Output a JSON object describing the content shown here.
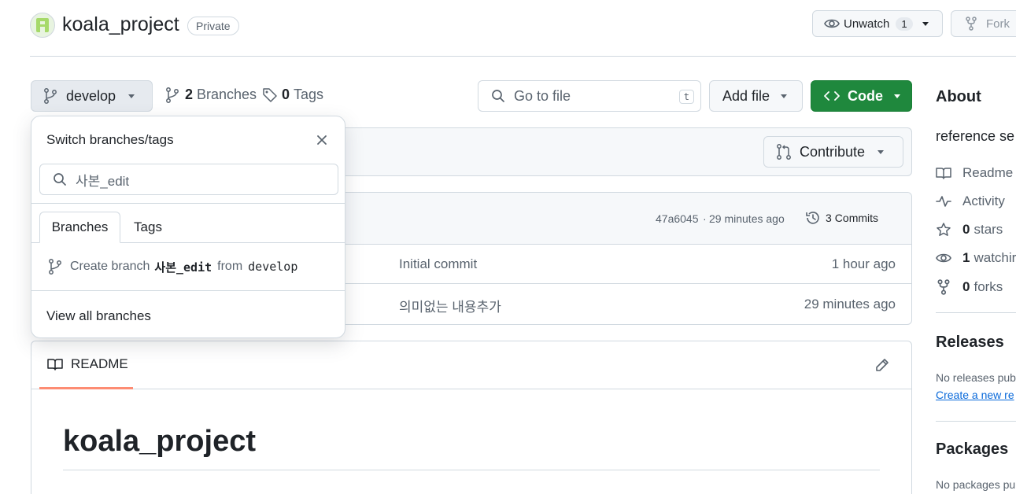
{
  "repo": {
    "name": "koala_project",
    "visibility": "Private"
  },
  "header": {
    "unwatch_label": "Unwatch",
    "watch_count": "1",
    "fork_label": "Fork"
  },
  "toolbar": {
    "branch_name": "develop",
    "branches_count": "2",
    "branches_label": "Branches",
    "tags_count": "0",
    "tags_label": "Tags",
    "go_to_file_placeholder": "Go to file",
    "go_to_file_key": "t",
    "add_file_label": "Add file",
    "code_label": "Code"
  },
  "contribute_label": "Contribute",
  "commit_bar": {
    "hash": "47a6045",
    "separator": "·",
    "time": "29 minutes ago",
    "commits_count": "3",
    "commits_label": "Commits"
  },
  "files": [
    {
      "message": "Initial commit",
      "time": "1 hour ago"
    },
    {
      "message": "의미없는 내용추가",
      "time": "29 minutes ago"
    }
  ],
  "readme": {
    "tab_label": "README",
    "heading": "koala_project"
  },
  "dropdown": {
    "title": "Switch branches/tags",
    "search_value": "사본_edit",
    "tabs": [
      "Branches",
      "Tags"
    ],
    "create_prefix": "Create branch",
    "create_branch": "사본_edit",
    "create_from": "from",
    "create_source": "develop",
    "view_all": "View all branches"
  },
  "about": {
    "title": "About",
    "description": "reference se",
    "items": [
      {
        "icon": "book-icon",
        "count": "",
        "label": "Readme"
      },
      {
        "icon": "pulse-icon",
        "count": "",
        "label": "Activity"
      },
      {
        "icon": "star-icon",
        "count": "0",
        "label": "stars"
      },
      {
        "icon": "eye-icon",
        "count": "1",
        "label": "watchir"
      },
      {
        "icon": "fork-icon",
        "count": "0",
        "label": "forks"
      }
    ]
  },
  "releases": {
    "title": "Releases",
    "empty": "No releases pub",
    "create_link": "Create a new re"
  },
  "packages": {
    "title": "Packages",
    "empty": "No packages pu"
  },
  "colors": {
    "code_green": "#1f883d",
    "readme_underline": "#fd8c73",
    "link": "#0969da"
  }
}
